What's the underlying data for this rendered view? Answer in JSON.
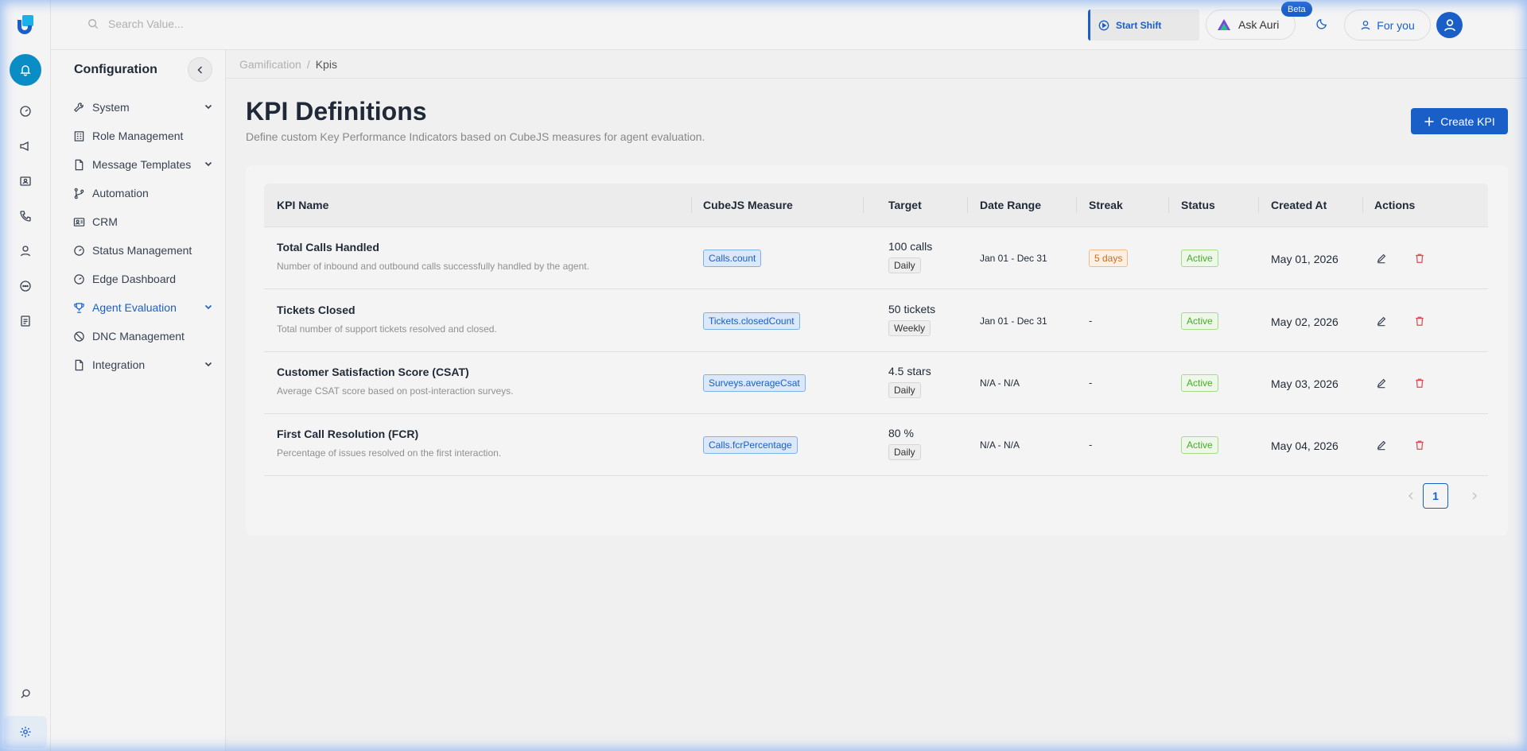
{
  "topbar": {
    "search_placeholder": "Search Value...",
    "start_shift": "Start Shift",
    "ask_auri": "Ask Auri",
    "beta": "Beta",
    "for_you": "For you"
  },
  "rail": {
    "icons": [
      "logo-icon",
      "bell-icon",
      "dashboard-icon",
      "megaphone-icon",
      "id-card-icon",
      "phone-icon",
      "user-icon",
      "chat-icon",
      "report-icon",
      "search-settings-icon",
      "gear-icon"
    ]
  },
  "sidenav": {
    "title": "Configuration",
    "items": [
      {
        "label": "System",
        "icon": "wrench-icon",
        "expandable": true
      },
      {
        "label": "Role Management",
        "icon": "building-icon",
        "expandable": false
      },
      {
        "label": "Message Templates",
        "icon": "file-icon",
        "expandable": true
      },
      {
        "label": "Automation",
        "icon": "branch-icon",
        "expandable": false
      },
      {
        "label": "CRM",
        "icon": "contact-card-icon",
        "expandable": false
      },
      {
        "label": "Status Management",
        "icon": "gauge-icon",
        "expandable": false
      },
      {
        "label": "Edge Dashboard",
        "icon": "gauge-icon",
        "expandable": false
      },
      {
        "label": "Agent Evaluation",
        "icon": "trophy-icon",
        "expandable": true,
        "active": true
      },
      {
        "label": "DNC Management",
        "icon": "block-icon",
        "expandable": false
      },
      {
        "label": "Integration",
        "icon": "file-icon",
        "expandable": true
      }
    ]
  },
  "breadcrumb": {
    "root": "Gamification",
    "separator": "/",
    "current": "Kpis"
  },
  "page": {
    "title": "KPI Definitions",
    "subtitle": "Define custom Key Performance Indicators based on CubeJS measures for agent evaluation.",
    "create_button": "Create KPI"
  },
  "table": {
    "columns": [
      "KPI Name",
      "CubeJS Measure",
      "Target",
      "Date Range",
      "Streak",
      "Status",
      "Created At",
      "Actions"
    ],
    "rows": [
      {
        "name": "Total Calls Handled",
        "description": "Number of inbound and outbound calls successfully handled by the agent.",
        "measure": "Calls.count",
        "target": "100 calls",
        "period": "Daily",
        "date_range": "Jan 01 - Dec 31",
        "streak": "5 days",
        "status": "Active",
        "created": "May 01, 2026"
      },
      {
        "name": "Tickets Closed",
        "description": "Total number of support tickets resolved and closed.",
        "measure": "Tickets.closedCount",
        "target": "50 tickets",
        "period": "Weekly",
        "date_range": "Jan 01 - Dec 31",
        "streak": "-",
        "status": "Active",
        "created": "May 02, 2026"
      },
      {
        "name": "Customer Satisfaction Score (CSAT)",
        "description": "Average CSAT score based on post-interaction surveys.",
        "measure": "Surveys.averageCsat",
        "target": "4.5 stars",
        "period": "Daily",
        "date_range": "N/A - N/A",
        "streak": "-",
        "status": "Active",
        "created": "May 03, 2026"
      },
      {
        "name": "First Call Resolution (FCR)",
        "description": "Percentage of issues resolved on the first interaction.",
        "measure": "Calls.fcrPercentage",
        "target": "80 %",
        "period": "Daily",
        "date_range": "N/A - N/A",
        "streak": "-",
        "status": "Active",
        "created": "May 04, 2026"
      }
    ]
  },
  "pagination": {
    "current_page": "1"
  },
  "colors": {
    "accent": "#1a5fc8",
    "teal": "#0a8cc4",
    "active_green": "#4aa82a",
    "streak_orange": "#d26a1b",
    "delete_red": "#e0484e"
  }
}
